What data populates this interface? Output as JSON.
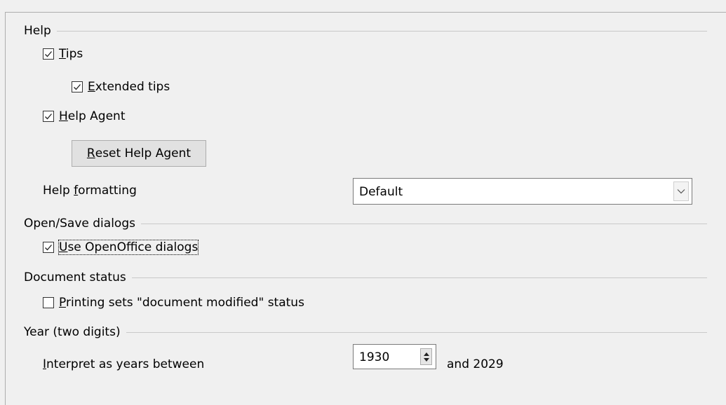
{
  "help": {
    "section_title": "Help",
    "tips": {
      "label_first": "T",
      "label_rest": "ips",
      "checked": true
    },
    "extended_tips": {
      "label_first": "E",
      "label_rest": "xtended tips",
      "checked": true
    },
    "help_agent": {
      "label_first": "H",
      "label_rest": "elp Agent",
      "checked": true
    },
    "reset_button": {
      "label_first": "R",
      "label_rest": "eset Help Agent"
    },
    "formatting": {
      "label_before": "Help ",
      "label_u": "f",
      "label_after": "ormatting",
      "selected": "Default"
    }
  },
  "open_save": {
    "section_title": "Open/Save dialogs",
    "use_oo_dialogs": {
      "label_first": "U",
      "label_rest": "se OpenOffice dialogs",
      "checked": true
    }
  },
  "document_status": {
    "section_title": "Document status",
    "printing": {
      "label_first": "P",
      "label_rest": "rinting sets \"document modified\" status",
      "checked": false
    }
  },
  "year": {
    "section_title": "Year (two digits)",
    "interpret": {
      "label_first": "I",
      "label_rest": "nterpret as years between",
      "start_value": "1930",
      "end_text": "and 2029"
    }
  }
}
